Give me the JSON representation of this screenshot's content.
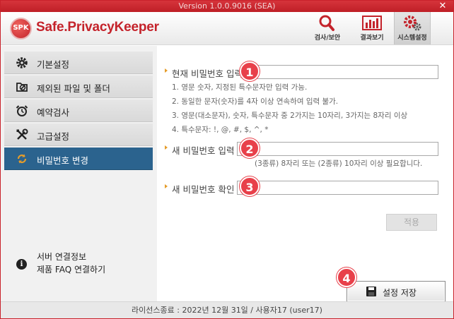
{
  "titlebar": {
    "version": "Version 1.0.0.9016 (SEA)",
    "close": "✕"
  },
  "header": {
    "logo_text": "SPK",
    "brand": "Safe.PrivacyKeeper",
    "nav": [
      {
        "label": "검사/보안",
        "icon": "magnifier-icon"
      },
      {
        "label": "결과보기",
        "icon": "bar-chart-icon"
      },
      {
        "label": "시스템설정",
        "icon": "gears-icon",
        "active": true
      }
    ]
  },
  "sidebar": {
    "items": [
      {
        "label": "기본설정",
        "icon": "gear-icon"
      },
      {
        "label": "제외된 파일 및 폴더",
        "icon": "exclude-folder-icon"
      },
      {
        "label": "예약검사",
        "icon": "alarm-clock-icon"
      },
      {
        "label": "고급설정",
        "icon": "tools-icon"
      },
      {
        "label": "비밀번호 변경",
        "icon": "refresh-icon",
        "active": true
      }
    ],
    "info": {
      "server": "서버 연결정보",
      "faq": "제품 FAQ 연결하기",
      "icon": "info-icon"
    }
  },
  "form": {
    "current_password": {
      "label": "현재 비밀번호 입력",
      "value": ""
    },
    "rules": [
      "1. 영문 숫자, 지정된 특수문자만 입력 가능.",
      "2. 동일한 문자(숫자)를 4자 이상 연속하여 입력 불가.",
      "3. 영문(대소문자), 숫자, 특수문자 중 2가지는 10자리, 3가지는 8자리 이상",
      "4. 특수문자: !, @, #, $, ^, *"
    ],
    "new_password": {
      "label": "새 비밀번호 입력",
      "value": ""
    },
    "hint": "(3종류) 8자리 또는 (2종류) 10자리 이상 필요합니다.",
    "confirm_password": {
      "label": "새 비밀번호 확인",
      "value": ""
    },
    "apply_label": "적용",
    "save_label": "설정 저장"
  },
  "badges": [
    "1",
    "2",
    "3",
    "4"
  ],
  "statusbar": {
    "text": "라이선스종료 : 2022년 12월 31일 / 사용자17 (user17)"
  },
  "colors": {
    "accent_red": "#c4232b",
    "active_blue": "#2b638e",
    "badge_red": "#e8404a",
    "bullet_orange": "#e59c2a"
  }
}
